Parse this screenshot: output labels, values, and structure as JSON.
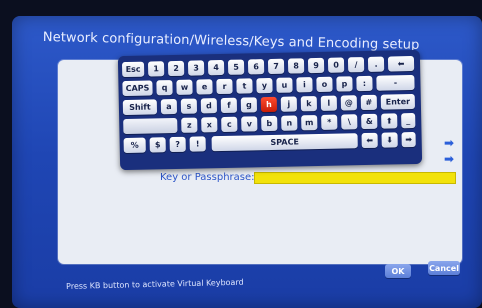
{
  "title": "Network configuration/Wireless/Keys and Encoding setup",
  "keyboard": {
    "row1": [
      "Esc",
      "1",
      "2",
      "3",
      "4",
      "5",
      "6",
      "7",
      "8",
      "9",
      "0",
      "/",
      ".",
      "⬅"
    ],
    "row2": [
      "CAPS",
      "q",
      "w",
      "e",
      "r",
      "t",
      "y",
      "u",
      "i",
      "o",
      "p",
      ":",
      "-"
    ],
    "row3": [
      "Shift",
      "a",
      "s",
      "d",
      "f",
      "g",
      "h",
      "j",
      "k",
      "l",
      "@",
      "#",
      "Enter"
    ],
    "row4": [
      "",
      "z",
      "x",
      "c",
      "v",
      "b",
      "n",
      "m",
      "*",
      "\\",
      "&",
      "⬆",
      "_"
    ],
    "row5": [
      "%",
      "$",
      "?",
      "!",
      "SPACE",
      "⬅",
      "⬇",
      "➡"
    ],
    "active_key": "h"
  },
  "form": {
    "key_label": "Key or Passphrase:",
    "key_value": ""
  },
  "footer": {
    "status": "Press KB button to activate Virtual Keyboard",
    "ok_label": "OK",
    "cancel_label": "Cancel"
  },
  "colors": {
    "background_blue": "#1f46b4",
    "keyboard_frame": "#1a2f7d",
    "active_key": "#e0260c",
    "passphrase_field": "#f2e20a",
    "button_blue": "#6f8fe2"
  },
  "icons": [
    "arrow-right-icon",
    "arrow-right-icon"
  ]
}
